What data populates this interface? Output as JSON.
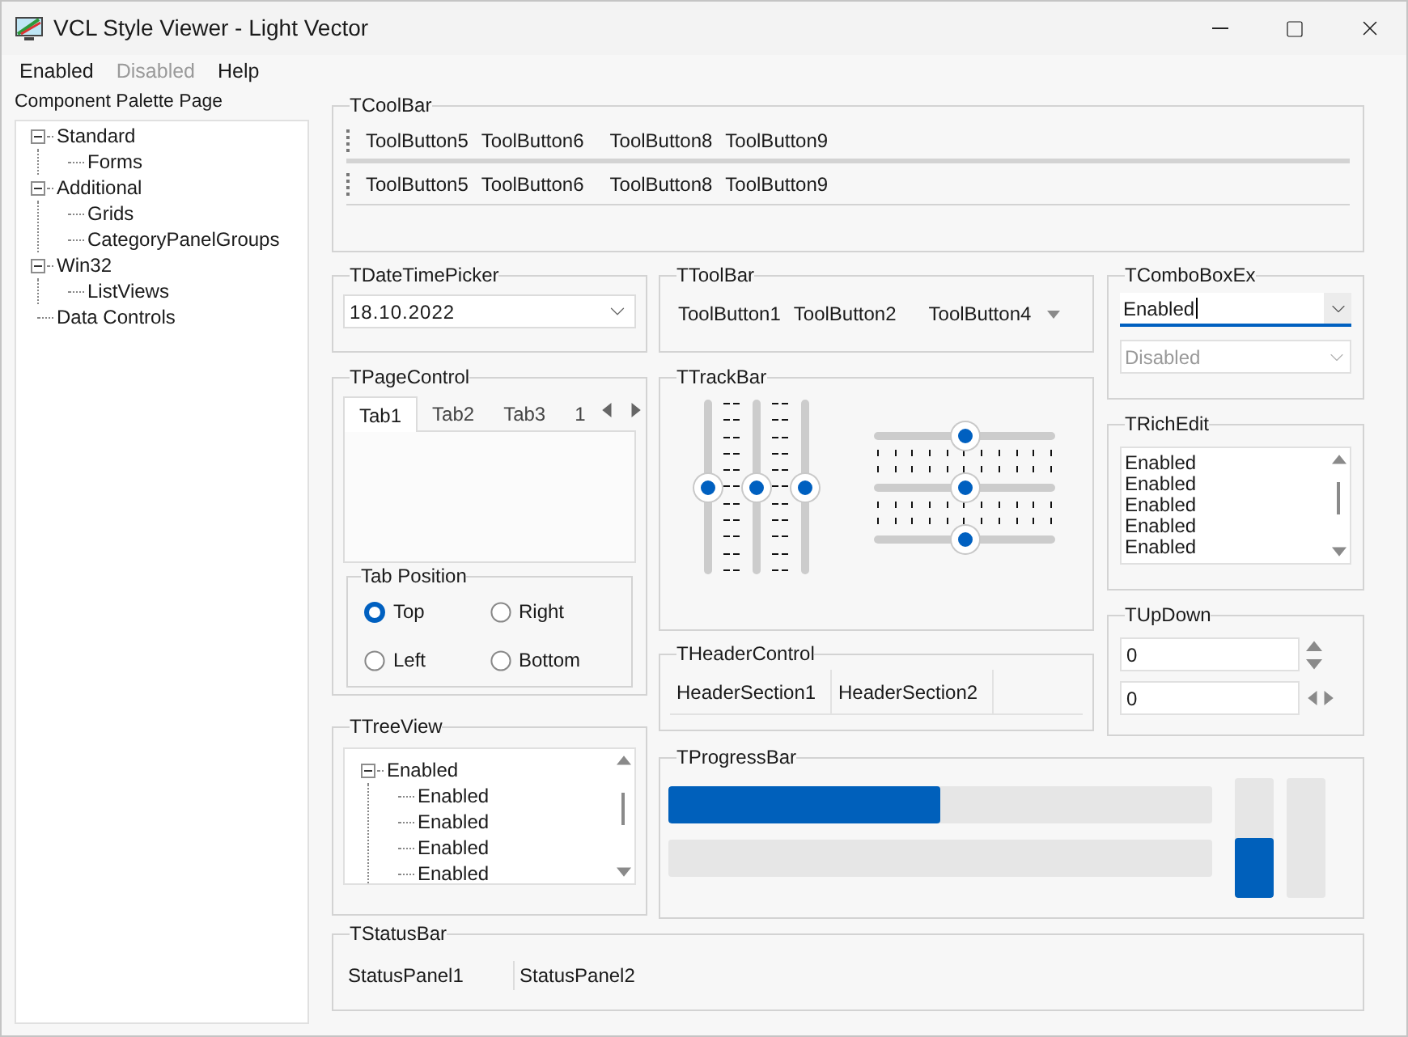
{
  "window": {
    "title": "VCL Style Viewer - Light Vector"
  },
  "menu": [
    {
      "label": "Enabled",
      "disabled": false
    },
    {
      "label": "Disabled",
      "disabled": true
    },
    {
      "label": "Help",
      "disabled": false
    }
  ],
  "palette": {
    "title": "Component Palette Page",
    "items": [
      {
        "label": "Standard",
        "expanded": true,
        "children": [
          {
            "label": "Forms"
          }
        ]
      },
      {
        "label": "Additional",
        "expanded": true,
        "children": [
          {
            "label": "Grids"
          },
          {
            "label": "CategoryPanelGroups"
          }
        ]
      },
      {
        "label": "Win32",
        "expanded": true,
        "children": [
          {
            "label": "ListViews"
          }
        ]
      },
      {
        "label": "Data Controls"
      }
    ]
  },
  "coolbar": {
    "title": "TCoolBar",
    "bands": [
      {
        "buttons": [
          {
            "kind": "button",
            "label": "ToolButton5"
          },
          {
            "kind": "button",
            "label": "ToolButton6"
          },
          {
            "kind": "separator"
          },
          {
            "kind": "button",
            "label": "ToolButton8"
          },
          {
            "kind": "button",
            "label": "ToolButton9"
          }
        ]
      },
      {
        "buttons": [
          {
            "kind": "button",
            "label": "ToolButton5"
          },
          {
            "kind": "button",
            "label": "ToolButton6"
          },
          {
            "kind": "separator"
          },
          {
            "kind": "button",
            "label": "ToolButton8"
          },
          {
            "kind": "button",
            "label": "ToolButton9"
          }
        ]
      }
    ]
  },
  "datetimepicker": {
    "title": "TDateTimePicker",
    "value": "18.10.2022"
  },
  "pagecontrol": {
    "title": "TPageControl",
    "tabs": [
      {
        "label": "Tab1",
        "selected": true
      },
      {
        "label": "Tab2",
        "selected": false
      },
      {
        "label": "Tab3",
        "selected": false
      },
      {
        "label": "1",
        "selected": false
      }
    ],
    "tab_position": {
      "title": "Tab Position",
      "options": [
        {
          "label": "Top",
          "selected": true
        },
        {
          "label": "Right",
          "selected": false
        },
        {
          "label": "Left",
          "selected": false
        },
        {
          "label": "Bottom",
          "selected": false
        }
      ]
    }
  },
  "treeview": {
    "title": "TTreeView",
    "items": [
      {
        "label": "Enabled",
        "expanded": true,
        "children": [
          {
            "label": "Enabled"
          },
          {
            "label": "Enabled"
          },
          {
            "label": "Enabled"
          },
          {
            "label": "Enabled"
          }
        ]
      }
    ]
  },
  "toolbar": {
    "title": "TToolBar",
    "buttons": [
      {
        "kind": "button",
        "label": "ToolButton1"
      },
      {
        "kind": "button",
        "label": "ToolButton2"
      },
      {
        "kind": "separator"
      },
      {
        "kind": "dropdown",
        "label": "ToolButton4"
      }
    ]
  },
  "trackbar": {
    "title": "TTrackBar",
    "vertical": [
      {
        "level": 0.5,
        "kind": "after"
      },
      {
        "level": 0.5,
        "kind": "both"
      },
      {
        "level": 0.5,
        "kind": "before"
      }
    ],
    "horizontal": [
      {
        "level": 0.5,
        "kind": "after"
      },
      {
        "level": 0.5,
        "kind": "both"
      },
      {
        "level": 0.5,
        "kind": "before"
      }
    ]
  },
  "headercontrol": {
    "title": "THeaderControl",
    "sections": [
      "HeaderSection1",
      "HeaderSection2"
    ]
  },
  "comboboxex": {
    "title": "TComboBoxEx",
    "combos": [
      {
        "value": "Enabled",
        "disabled": false,
        "focused": true
      },
      {
        "value": "Disabled",
        "disabled": true,
        "focused": false
      }
    ]
  },
  "richedit": {
    "title": "TRichEdit",
    "lines": [
      "Enabled",
      "Enabled",
      "Enabled",
      "Enabled",
      "Enabled"
    ]
  },
  "updown": {
    "title": "TUpDown",
    "fields": [
      {
        "value": "0",
        "kind": "vertical"
      },
      {
        "value": "0",
        "kind": "horizontal"
      }
    ]
  },
  "progressbar": {
    "title": "TProgressBar",
    "horizontal_bars": [
      {
        "level": 0.5
      },
      {
        "level": 0
      }
    ],
    "vertical_bars": [
      {
        "level": 0.5
      },
      {
        "level": 0
      }
    ]
  },
  "statusbar": {
    "title": "TStatusBar",
    "panels": [
      "StatusPanel1",
      "StatusPanel2"
    ]
  }
}
